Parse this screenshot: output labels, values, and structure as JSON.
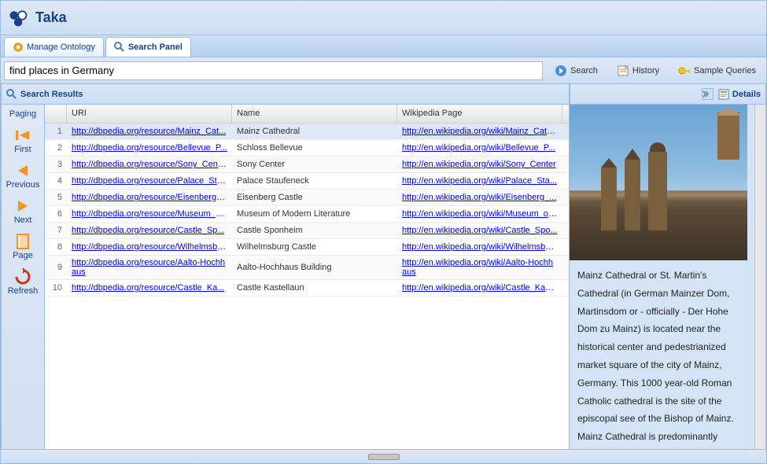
{
  "app": {
    "title": "Taka"
  },
  "tabs": {
    "manage_ontology": "Manage Ontology",
    "search_panel": "Search Panel"
  },
  "search": {
    "value": "find places in Germany",
    "search_btn": "Search",
    "history_btn": "History",
    "sample_btn": "Sample Queries"
  },
  "panels": {
    "results_title": "Search Results",
    "details_title": "Details"
  },
  "paging": {
    "head": "Paging",
    "first": "First",
    "previous": "Previous",
    "next": "Next",
    "page": "Page",
    "refresh": "Refresh"
  },
  "grid": {
    "columns": {
      "uri": "URI",
      "name": "Name",
      "wiki": "Wikipedia Page"
    },
    "rows": [
      {
        "idx": "1",
        "uri": "http://dbpedia.org/resource/Mainz_Cat...",
        "name": "Mainz Cathedral",
        "wiki": "http://en.wikipedia.org/wiki/Mainz_Cath..."
      },
      {
        "idx": "2",
        "uri": "http://dbpedia.org/resource/Bellevue_P...",
        "name": "Schloss Bellevue",
        "wiki": "http://en.wikipedia.org/wiki/Bellevue_P..."
      },
      {
        "idx": "3",
        "uri": "http://dbpedia.org/resource/Sony_Center",
        "name": "Sony Center",
        "wiki": "http://en.wikipedia.org/wiki/Sony_Center"
      },
      {
        "idx": "4",
        "uri": "http://dbpedia.org/resource/Palace_Sta...",
        "name": "Palace Staufeneck",
        "wiki": "http://en.wikipedia.org/wiki/Palace_Sta..."
      },
      {
        "idx": "5",
        "uri": "http://dbpedia.org/resource/Eisenberg_...",
        "name": "Eisenberg Castle",
        "wiki": "http://en.wikipedia.org/wiki/Eisenberg_..."
      },
      {
        "idx": "6",
        "uri": "http://dbpedia.org/resource/Museum_o...",
        "name": "Museum of Modern Literature",
        "wiki": "http://en.wikipedia.org/wiki/Museum_of..."
      },
      {
        "idx": "7",
        "uri": "http://dbpedia.org/resource/Castle_Sp...",
        "name": "Castle Sponheim",
        "wiki": "http://en.wikipedia.org/wiki/Castle_Spo..."
      },
      {
        "idx": "8",
        "uri": "http://dbpedia.org/resource/Wilhelmsbu...",
        "name": "Wilhelmsburg Castle",
        "wiki": "http://en.wikipedia.org/wiki/Wilhelmsbur..."
      },
      {
        "idx": "9",
        "uri": "http://dbpedia.org/resource/Aalto-Hochhaus",
        "name": "Aalto-Hochhaus Building",
        "wiki": "http://en.wikipedia.org/wiki/Aalto-Hochhaus"
      },
      {
        "idx": "10",
        "uri": "http://dbpedia.org/resource/Castle_Ka...",
        "name": "Castle Kastellaun",
        "wiki": "http://en.wikipedia.org/wiki/Castle_Kast..."
      }
    ]
  },
  "details": {
    "text": "Mainz Cathedral or St. Martin's Cathedral (in German Mainzer Dom, Martinsdom or - officially - Der Hohe Dom zu Mainz) is located near the historical center and pedestrianized market square of the city of Mainz, Germany. This 1000 year-old Roman Catholic cathedral is the site of the episcopal see of the Bishop of Mainz. Mainz Cathedral is predominantly Romanesque in style, but later exterior"
  }
}
